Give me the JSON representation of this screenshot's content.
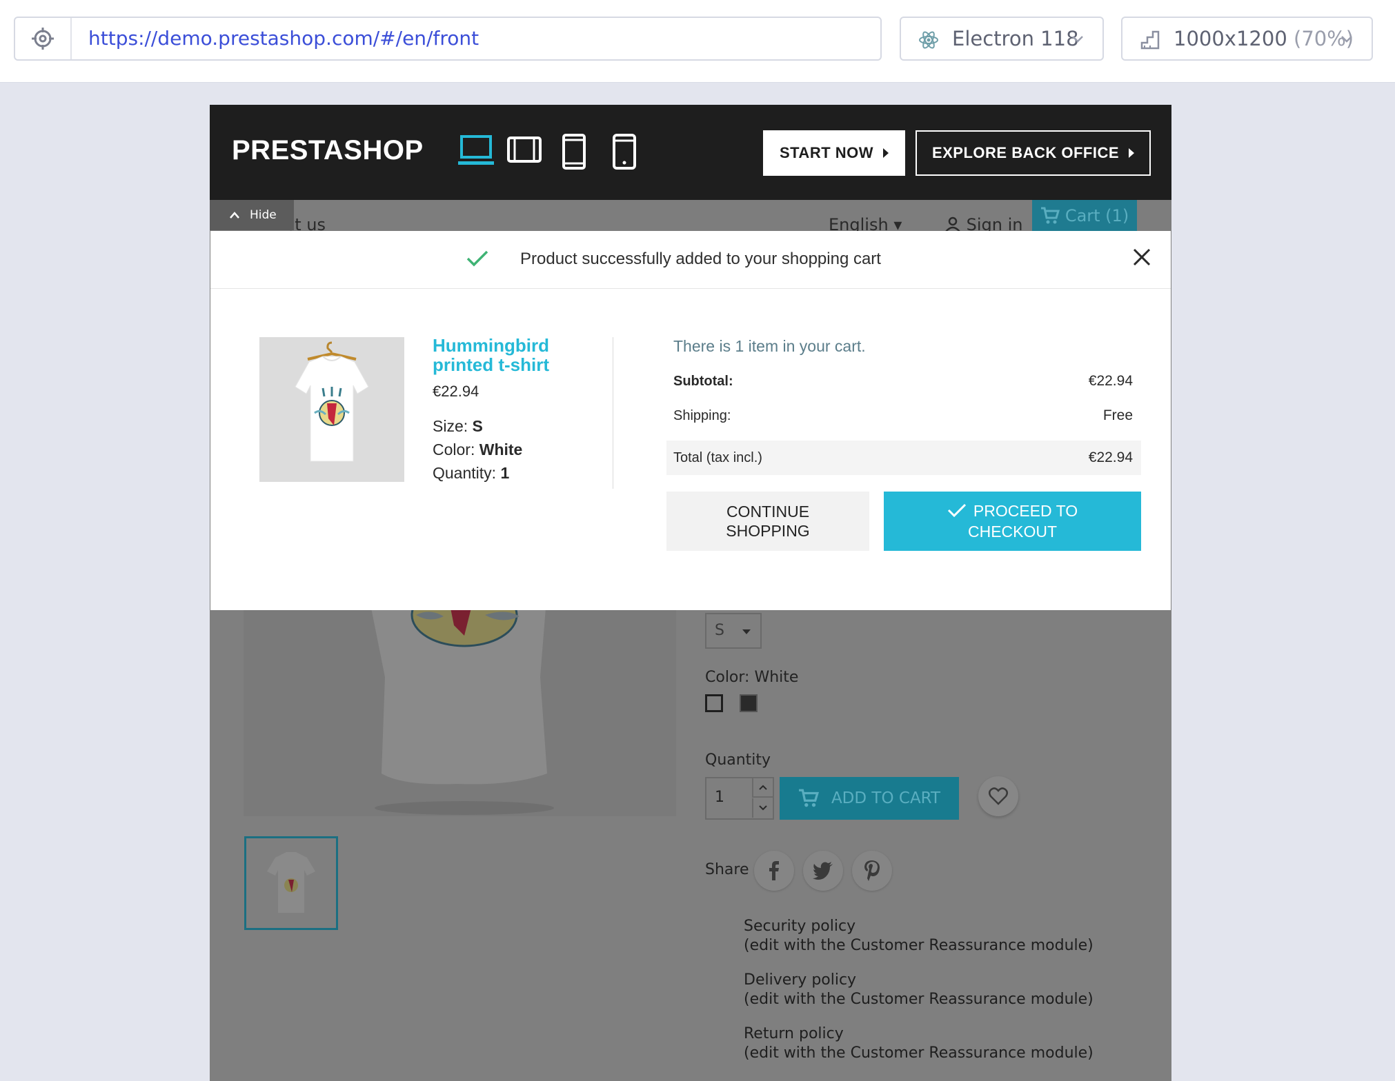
{
  "runner": {
    "url": "https://demo.prestashop.com/#/en/front",
    "browser": "Electron 118",
    "viewport": "1000x1200",
    "viewport_zoom": "(70%)"
  },
  "demo_bar": {
    "logo": "PRESTASHOP",
    "start_now": "START NOW",
    "explore": "EXPLORE BACK OFFICE",
    "hide": "Hide"
  },
  "shop_nav": {
    "contact_partial": "ct us",
    "language": "English",
    "sign_in": "Sign in",
    "cart": "Cart (1)"
  },
  "modal": {
    "message": "Product successfully added to your shopping cart",
    "product": {
      "name": "Hummingbird printed t-shirt",
      "price": "€22.94",
      "size_label": "Size:",
      "size": "S",
      "color_label": "Color:",
      "color": "White",
      "quantity_label": "Quantity:",
      "quantity": "1"
    },
    "cart_count": "There is 1 item in your cart.",
    "subtotal_label": "Subtotal:",
    "subtotal": "€22.94",
    "shipping_label": "Shipping:",
    "shipping": "Free",
    "total_label": "Total (tax incl.)",
    "total": "€22.94",
    "continue_line1": "CONTINUE",
    "continue_line2": "SHOPPING",
    "checkout_line1": "PROCEED TO",
    "checkout_line2": "CHECKOUT"
  },
  "product_page": {
    "size_value": "S",
    "color_label": "Color: White",
    "quantity_label": "Quantity",
    "quantity_value": "1",
    "add_to_cart": "ADD TO CART",
    "share": "Share",
    "policies": [
      {
        "title": "Security policy",
        "note": "(edit with the Customer Reassurance module)"
      },
      {
        "title": "Delivery policy",
        "note": "(edit with the Customer Reassurance module)"
      },
      {
        "title": "Return policy",
        "note": "(edit with the Customer Reassurance module)"
      }
    ]
  },
  "colors": {
    "accent": "#25b9d7",
    "dark": "#1e1e1e",
    "url": "#3b4ed8",
    "success": "#3fb374"
  }
}
